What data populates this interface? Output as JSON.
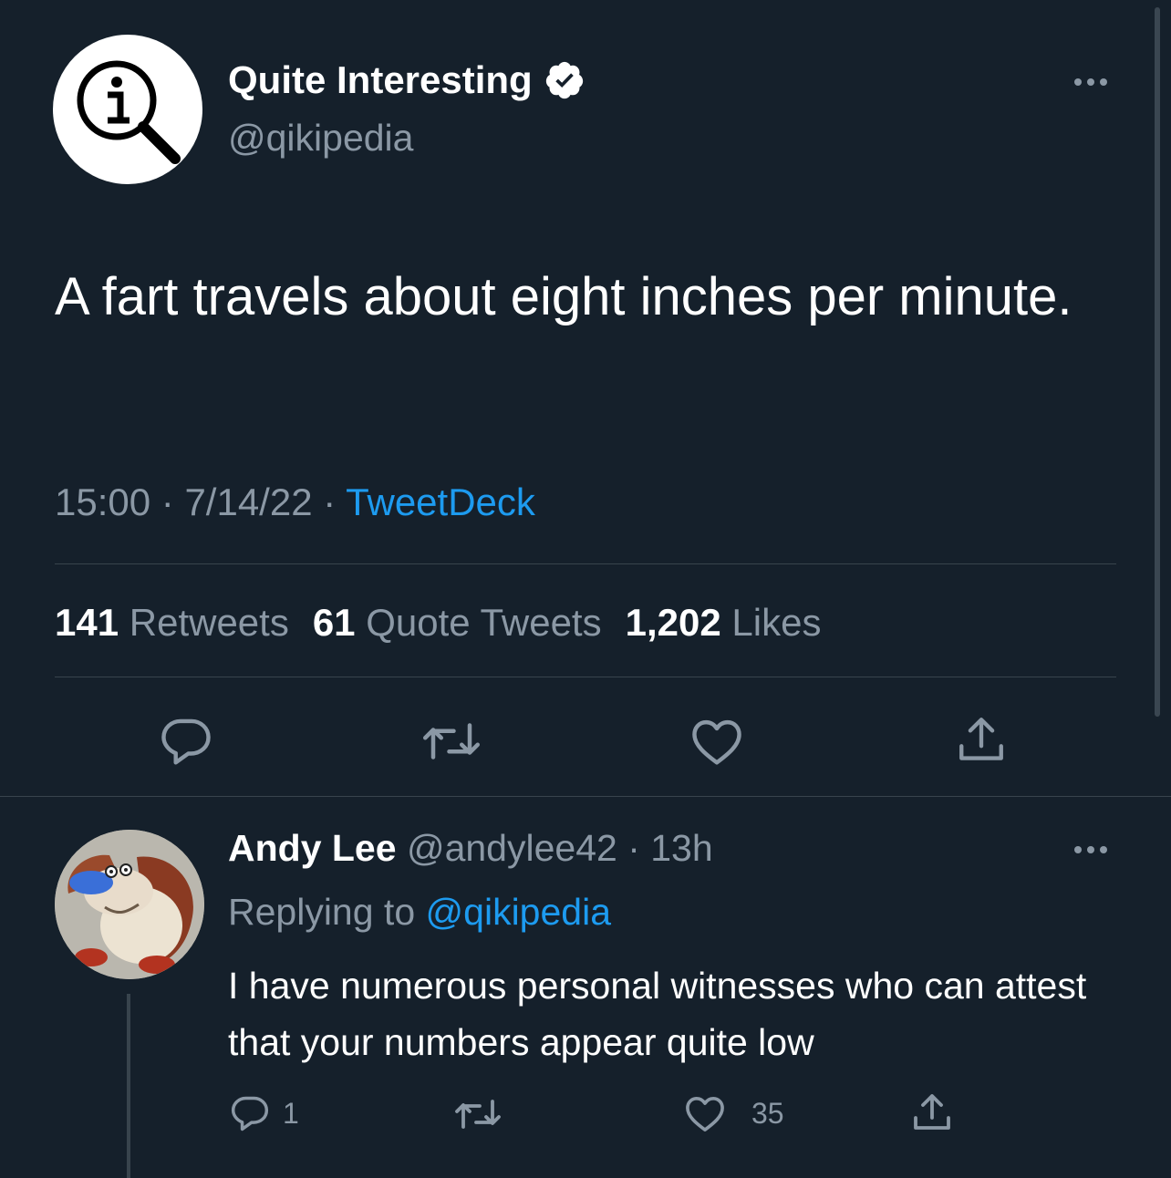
{
  "tweet": {
    "display_name": "Quite Interesting",
    "handle": "@qikipedia",
    "verified_icon": "verified-badge-icon",
    "avatar": "magnifying-glass-info-logo",
    "text": "A fart travels about eight inches per minute.",
    "time": "15:00",
    "date": "7/14/22",
    "source": "TweetDeck",
    "stats": {
      "retweets_count": "141",
      "retweets_label": "Retweets",
      "quotes_count": "61",
      "quotes_label": "Quote Tweets",
      "likes_count": "1,202",
      "likes_label": "Likes"
    },
    "actions": [
      "reply-icon",
      "retweet-icon",
      "like-icon",
      "share-icon"
    ]
  },
  "reply": {
    "display_name": "Andy Lee",
    "handle": "@andylee42",
    "age": "13h",
    "replying_prefix": "Replying to",
    "replying_to": "@qikipedia",
    "text": "I have numerous personal witnesses who can attest that your numbers appear quite low",
    "reply_count": "1",
    "like_count": "35",
    "avatar": "cartoon-dog-avatar"
  },
  "colors": {
    "background": "#15202b",
    "muted": "#8b98a5",
    "link": "#1d9bf0",
    "divider": "#38444d"
  }
}
